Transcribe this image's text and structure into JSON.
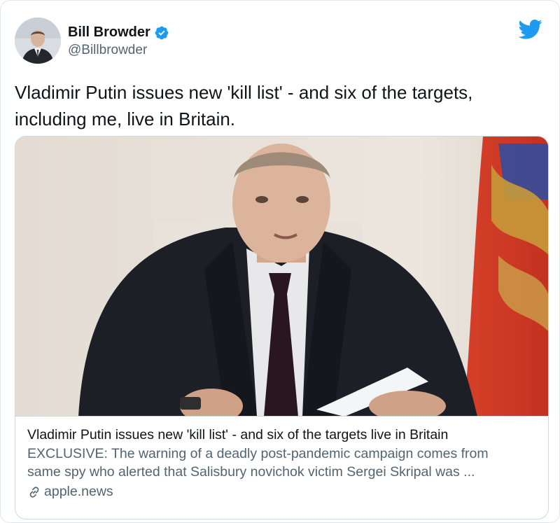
{
  "author": {
    "display_name": "Bill Browder",
    "handle": "@Billbrowder",
    "verified": true,
    "avatar_icon": "user-avatar-photo"
  },
  "brand": {
    "logo_icon": "twitter-bird-icon",
    "color": "#1d9bf0"
  },
  "tweet": {
    "text_line1": "Vladimir Putin issues new 'kill list' - and six of the targets,",
    "text_line2": "including me, live in Britain."
  },
  "card": {
    "image_icon": "article-photo",
    "title": "Vladimir Putin issues new 'kill list' - and six of the targets live in Britain",
    "description_line1": "EXCLUSIVE: The warning of a deadly post-pandemic campaign comes from",
    "description_line2": "same spy who alerted that Salisbury novichok victim Sergei Skripal was ...",
    "domain": "apple.news",
    "domain_icon": "link-icon"
  },
  "colors": {
    "text_primary": "#0f1419",
    "text_secondary": "#536471",
    "border": "#cfd9de"
  }
}
